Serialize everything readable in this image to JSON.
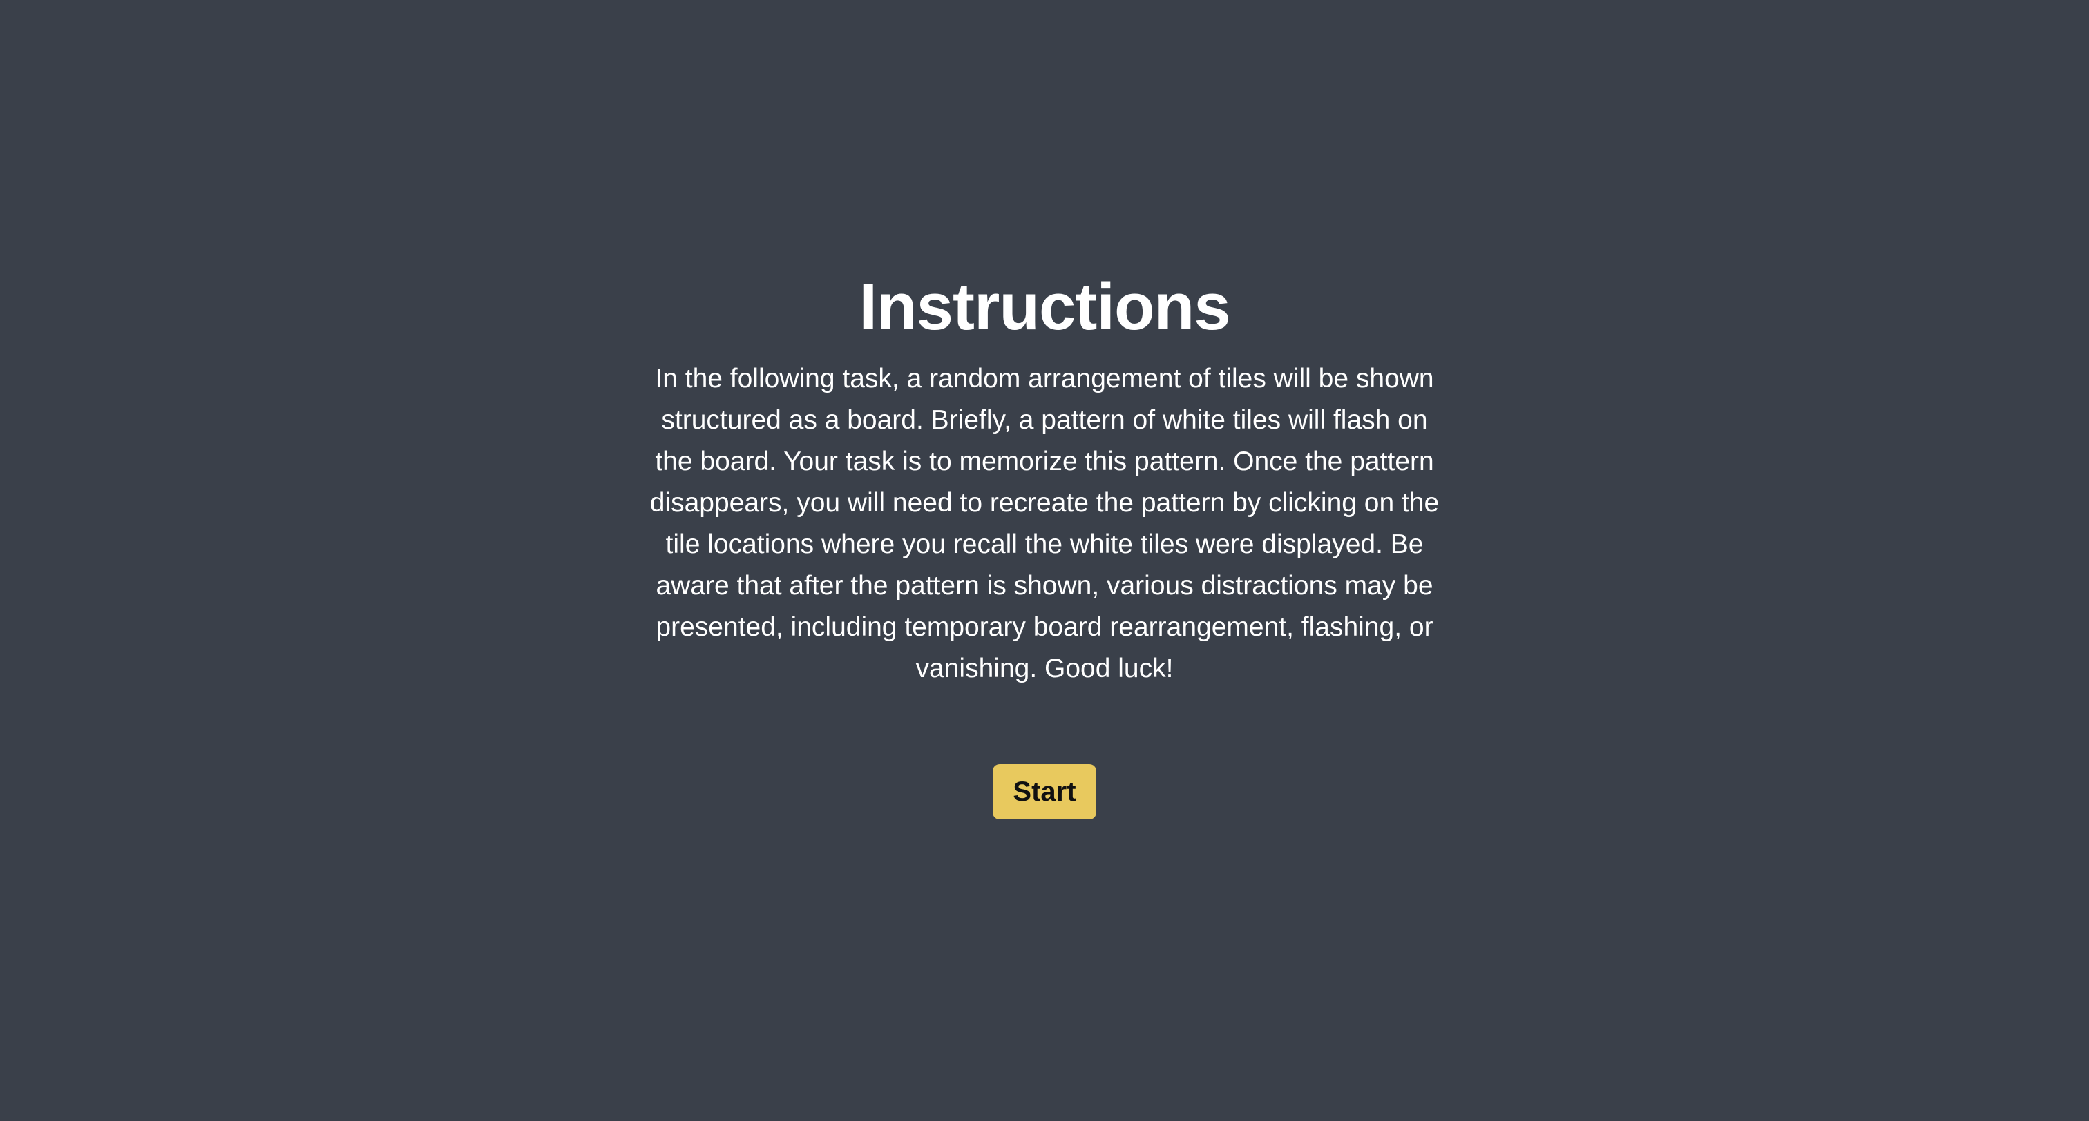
{
  "instructions": {
    "title": "Instructions",
    "body": "In the following task, a random arrangement of tiles will be shown structured as a board. Briefly, a pattern of white tiles will flash on the board. Your task is to memorize this pattern. Once the pattern disappears, you will need to recreate the pattern by clicking on the tile locations where you recall the white tiles were displayed. Be aware that after the pattern is shown, various distractions may be presented, including temporary board rearrangement, flashing, or vanishing. Good luck!",
    "start_label": "Start"
  },
  "colors": {
    "background": "#3a404a",
    "text": "#ffffff",
    "button_background": "#e8c95e",
    "button_text": "#111111"
  }
}
